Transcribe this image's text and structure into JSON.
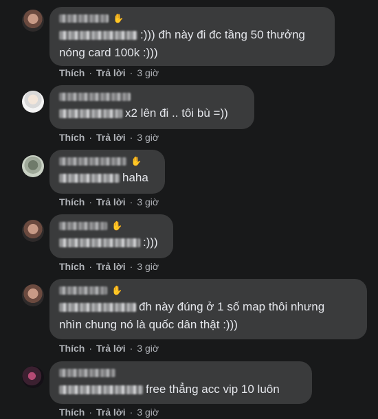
{
  "actions": {
    "like": "Thích",
    "reply": "Trả lời",
    "separator": "·"
  },
  "comments": [
    {
      "text": ":))) đh này đi đc tầng 50 thưởng",
      "text2": "nóng card 100k :)))",
      "time": "3 giờ"
    },
    {
      "text": "x2 lên đi .. tôi bù =))",
      "time": "3 giờ"
    },
    {
      "text": "haha",
      "time": "3 giờ"
    },
    {
      "text": ":)))",
      "time": "3 giờ"
    },
    {
      "text": "đh này đúng ở 1 số map thôi nhưng",
      "text2": "nhìn chung nó là quốc dân thật :)))",
      "time": "3 giờ"
    },
    {
      "text": "free thẳng acc vip 10 luôn",
      "time": "3 giờ"
    }
  ]
}
